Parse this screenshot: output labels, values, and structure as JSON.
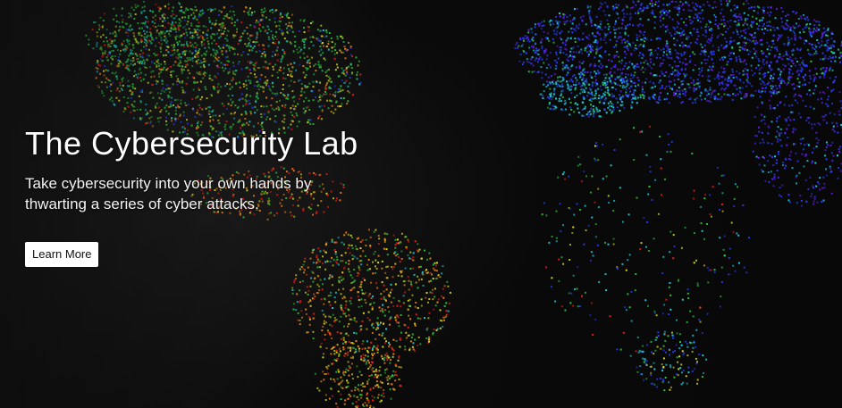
{
  "hero": {
    "title": "The Cybersecurity Lab",
    "subtitle": "Take cybersecurity into your own hands by thwarting a series of cyber attacks.",
    "cta_label": "Learn More"
  },
  "map": {
    "palette": {
      "red": "#ff1a1a",
      "orange": "#ff8c1a",
      "yellow": "#e6e61a",
      "green": "#2ecc40",
      "cyan": "#19d3e6",
      "blue": "#2b3cff",
      "violet": "#6a1aff"
    }
  }
}
